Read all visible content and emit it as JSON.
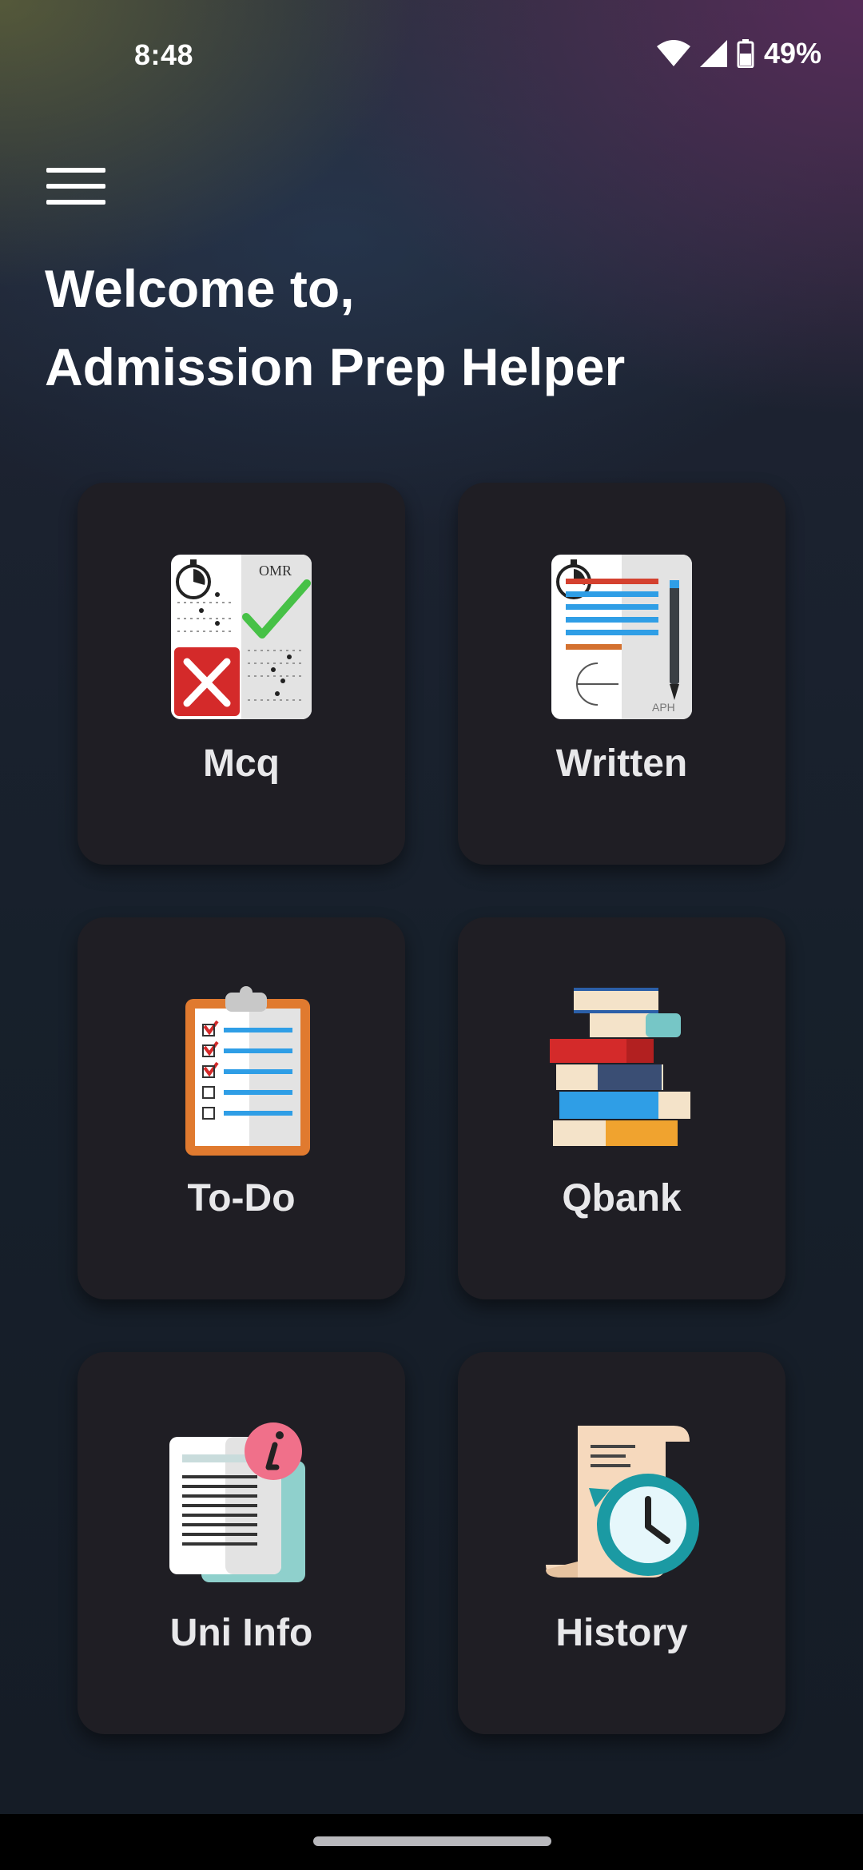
{
  "status_bar": {
    "time": "8:48",
    "battery": "49%"
  },
  "header": {
    "menu_icon": "hamburger-menu-icon",
    "greeting_line1": "Welcome to,",
    "greeting_line2": "Admission Prep Helper"
  },
  "cards": [
    {
      "label": "Mcq",
      "icon": "omr-sheet-icon"
    },
    {
      "label": "Written",
      "icon": "written-exam-icon"
    },
    {
      "label": "To-Do",
      "icon": "clipboard-checklist-icon"
    },
    {
      "label": "Qbank",
      "icon": "book-stack-icon"
    },
    {
      "label": "Uni Info",
      "icon": "info-document-icon"
    },
    {
      "label": "History",
      "icon": "history-clock-icon"
    }
  ],
  "colors": {
    "card_bg": "#1f1e24",
    "text": "#e8e8ea",
    "accent_red": "#d42a2a",
    "accent_green": "#47c147",
    "accent_blue": "#2f9ee6"
  }
}
